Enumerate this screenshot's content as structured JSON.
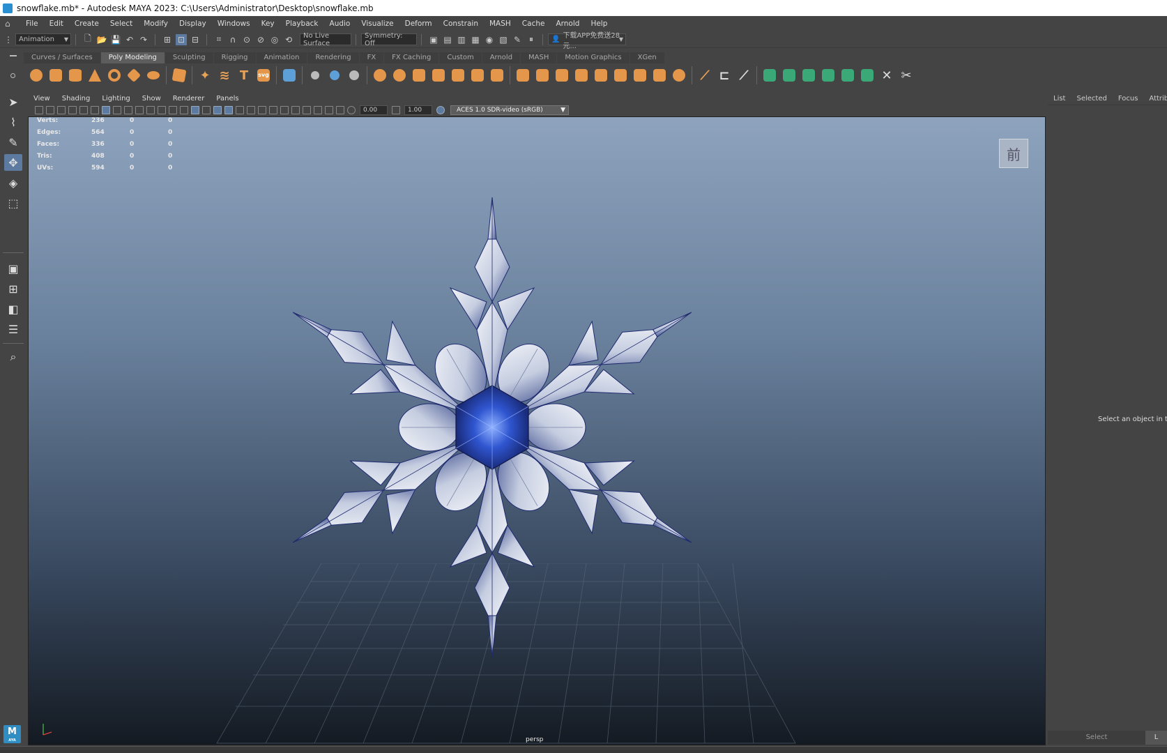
{
  "window": {
    "title": "snowflake.mb* - Autodesk MAYA 2023: C:\\Users\\Administrator\\Desktop\\snowflake.mb"
  },
  "menubar": {
    "items": [
      "File",
      "Edit",
      "Create",
      "Select",
      "Modify",
      "Display",
      "Windows",
      "Key",
      "Playback",
      "Audio",
      "Visualize",
      "Deform",
      "Constrain",
      "MASH",
      "Cache",
      "Arnold",
      "Help"
    ]
  },
  "toolbar": {
    "menuset": "Animation",
    "live_surface": "No Live Surface",
    "symmetry": "Symmetry: Off",
    "workspace_label": "下载APP免费送28元..."
  },
  "shelf": {
    "tabs": [
      "Curves / Surfaces",
      "Poly Modeling",
      "Sculpting",
      "Rigging",
      "Animation",
      "Rendering",
      "FX",
      "FX Caching",
      "Custom",
      "Arnold",
      "MASH",
      "Motion Graphics",
      "XGen"
    ],
    "active_tab": "Poly Modeling",
    "text_icon": "T",
    "svg_icon": "svg"
  },
  "panel": {
    "menus": [
      "View",
      "Shading",
      "Lighting",
      "Show",
      "Renderer",
      "Panels"
    ],
    "exposure": "0.00",
    "gamma": "1.00",
    "color_space": "ACES 1.0 SDR-video (sRGB)",
    "camera": "persp",
    "view_cube_label": "前"
  },
  "hud": {
    "rows": [
      {
        "label": "Verts:",
        "values": [
          "236",
          "0",
          "0"
        ]
      },
      {
        "label": "Edges:",
        "values": [
          "564",
          "0",
          "0"
        ]
      },
      {
        "label": "Faces:",
        "values": [
          "336",
          "0",
          "0"
        ]
      },
      {
        "label": "Tris:",
        "values": [
          "408",
          "0",
          "0"
        ]
      },
      {
        "label": "UVs:",
        "values": [
          "594",
          "0",
          "0"
        ]
      }
    ]
  },
  "right_panel": {
    "tabs": [
      "List",
      "Selected",
      "Focus",
      "Attributes"
    ],
    "message": "Select an object in the",
    "bottom_buttons": [
      "Select",
      "L"
    ]
  },
  "badge": {
    "label": "M",
    "sub": "AYA"
  }
}
